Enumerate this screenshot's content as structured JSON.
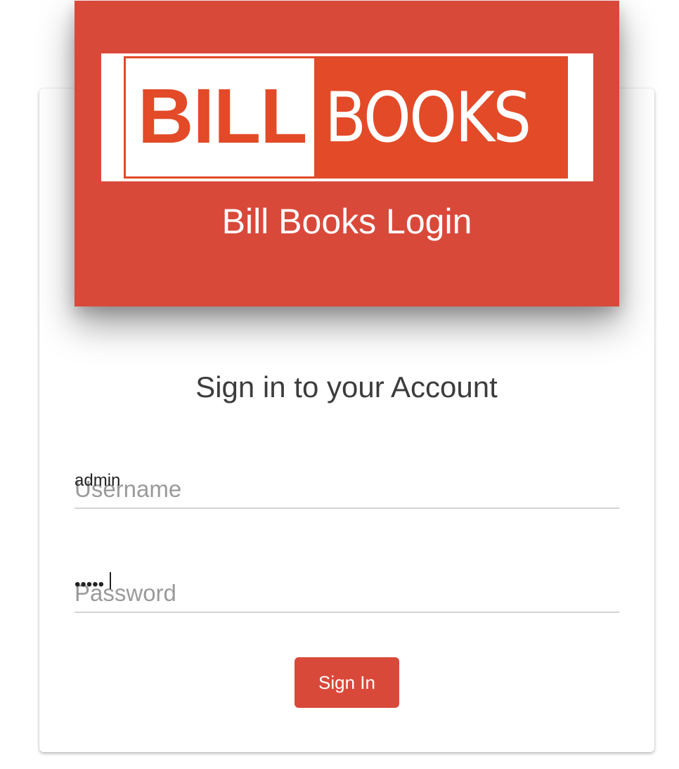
{
  "brand": {
    "logo_left_text": "BILL",
    "logo_right_text": "BOOKS",
    "header_title": "Bill Books Login",
    "accent_color": "#d9493a",
    "logo_color": "#e34a28"
  },
  "form": {
    "subtitle": "Sign in to your Account",
    "username": {
      "value": "admin",
      "placeholder": "Username"
    },
    "password": {
      "value": "•••••",
      "placeholder": "Password"
    },
    "submit_label": "Sign In"
  }
}
